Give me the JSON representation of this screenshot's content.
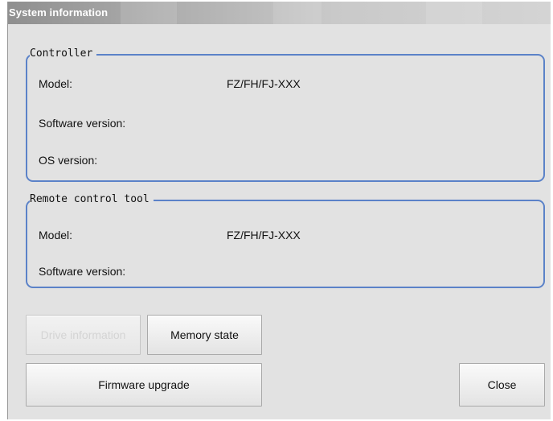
{
  "window": {
    "title": "System information"
  },
  "controller": {
    "group_label": "Controller",
    "model_label": "Model:",
    "model_value": "FZ/FH/FJ-XXX",
    "software_version_label": "Software version:",
    "software_version_value": "",
    "os_version_label": "OS version:",
    "os_version_value": ""
  },
  "remote_tool": {
    "group_label": "Remote control tool",
    "model_label": "Model:",
    "model_value": "FZ/FH/FJ-XXX",
    "software_version_label": "Software version:",
    "software_version_value": ""
  },
  "buttons": {
    "drive_information": "Drive information",
    "memory_state": "Memory state",
    "firmware_upgrade": "Firmware upgrade",
    "close": "Close"
  },
  "colors": {
    "group_border": "#5b82c8",
    "window_bg": "#e2e2e2",
    "titlebar_text": "#ffffff"
  }
}
